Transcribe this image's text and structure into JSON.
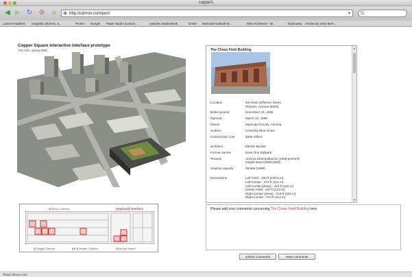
{
  "window": {
    "title": "copper1"
  },
  "toolbar": {
    "url": "http://cdmon.com/purl/"
  },
  "bookmarks": [
    "Latest Headlines",
    "craigslist: phoenix, a...",
    "Pronet",
    "Google",
    "Paper Studio (Lesson...",
    "samples.studentwork",
    "Gmail",
    "Microsoft Outlook W...",
    "Wiss Architects - W...",
    "bookcamp",
    "Articles by Jerry Bern..."
  ],
  "page": {
    "title": "Copper Square interactive interface prototype",
    "subtitle": "700 ASU, spring 2006"
  },
  "keyboard": {
    "title": "Keyboard Interface",
    "label_top": "Move Camera",
    "label_top_key": "W",
    "label_b1": "Toggle Camera",
    "label_b1_key": "Q",
    "label_b2": "Rotate Camera",
    "label_b2_key": "AS D",
    "label_b3": "Move the model"
  },
  "info": {
    "title": "The Chase Field Building",
    "facts": [
      {
        "label": "Location",
        "value": "401 East Jefferson Street\nPhoenix, Arizona 85001"
      },
      {
        "label": "Broke ground",
        "value": "November 16, 1995"
      },
      {
        "label": "Opened",
        "value": "March 31, 1998"
      },
      {
        "label": "Owner",
        "value": "Maricopa County, Arizona"
      },
      {
        "label": "Surface",
        "value": "Kentucky Blue Grass"
      },
      {
        "label": "Construction cost",
        "value": "$349 million"
      },
      {
        "label": "Architect",
        "value": "Ellerbe Becket"
      },
      {
        "label": "Former names",
        "value": "Bank One Ballpark"
      },
      {
        "label": "Tenants",
        "value": "Arizona Diamondbacks (1998-present)\nInsight Bowl (2000-2005)"
      },
      {
        "label": "Seating capacity",
        "value": "48,569 (1998)"
      },
      {
        "label": "Dimensions",
        "value": "Left Field - 330 ft (100.5 m)\nLeft-Center - 374 ft (114 m)\nLeft-Center (deep) - 413 ft (126 m)\nCenter Field - 407 ft (124 m)\nRight-Center (deep) - 413 ft (126 m)\nRight-Center - 374 ft (114 m)"
      }
    ]
  },
  "comments": {
    "prompt_start": "Please add your comments concerning",
    "prompt_building": "The Chase Field Building",
    "prompt_end": "here.",
    "value": ""
  },
  "buttons": {
    "submit": "submit comments",
    "reset": "reset comments"
  },
  "status": {
    "text": "Read cdmon.com"
  }
}
